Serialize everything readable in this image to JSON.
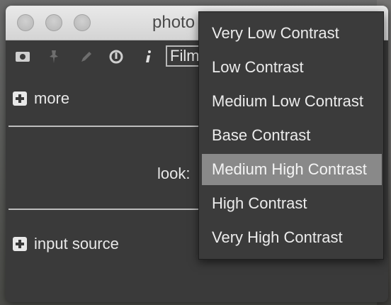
{
  "window": {
    "title": "photo"
  },
  "toolbar": {
    "icons": [
      "camera-icon",
      "pin-icon",
      "pencil-icon",
      "power-icon",
      "info-icon"
    ],
    "film_select_value": "Film"
  },
  "sections": {
    "more_label": "more",
    "look_label": "look:",
    "input_source_label": "input source"
  },
  "menu": {
    "items": [
      {
        "label": "Very Low Contrast"
      },
      {
        "label": "Low Contrast"
      },
      {
        "label": "Medium Low Contrast"
      },
      {
        "label": "Base Contrast"
      },
      {
        "label": "Medium High Contrast"
      },
      {
        "label": "High Contrast"
      },
      {
        "label": "Very High Contrast"
      }
    ],
    "highlighted_index": 4
  }
}
